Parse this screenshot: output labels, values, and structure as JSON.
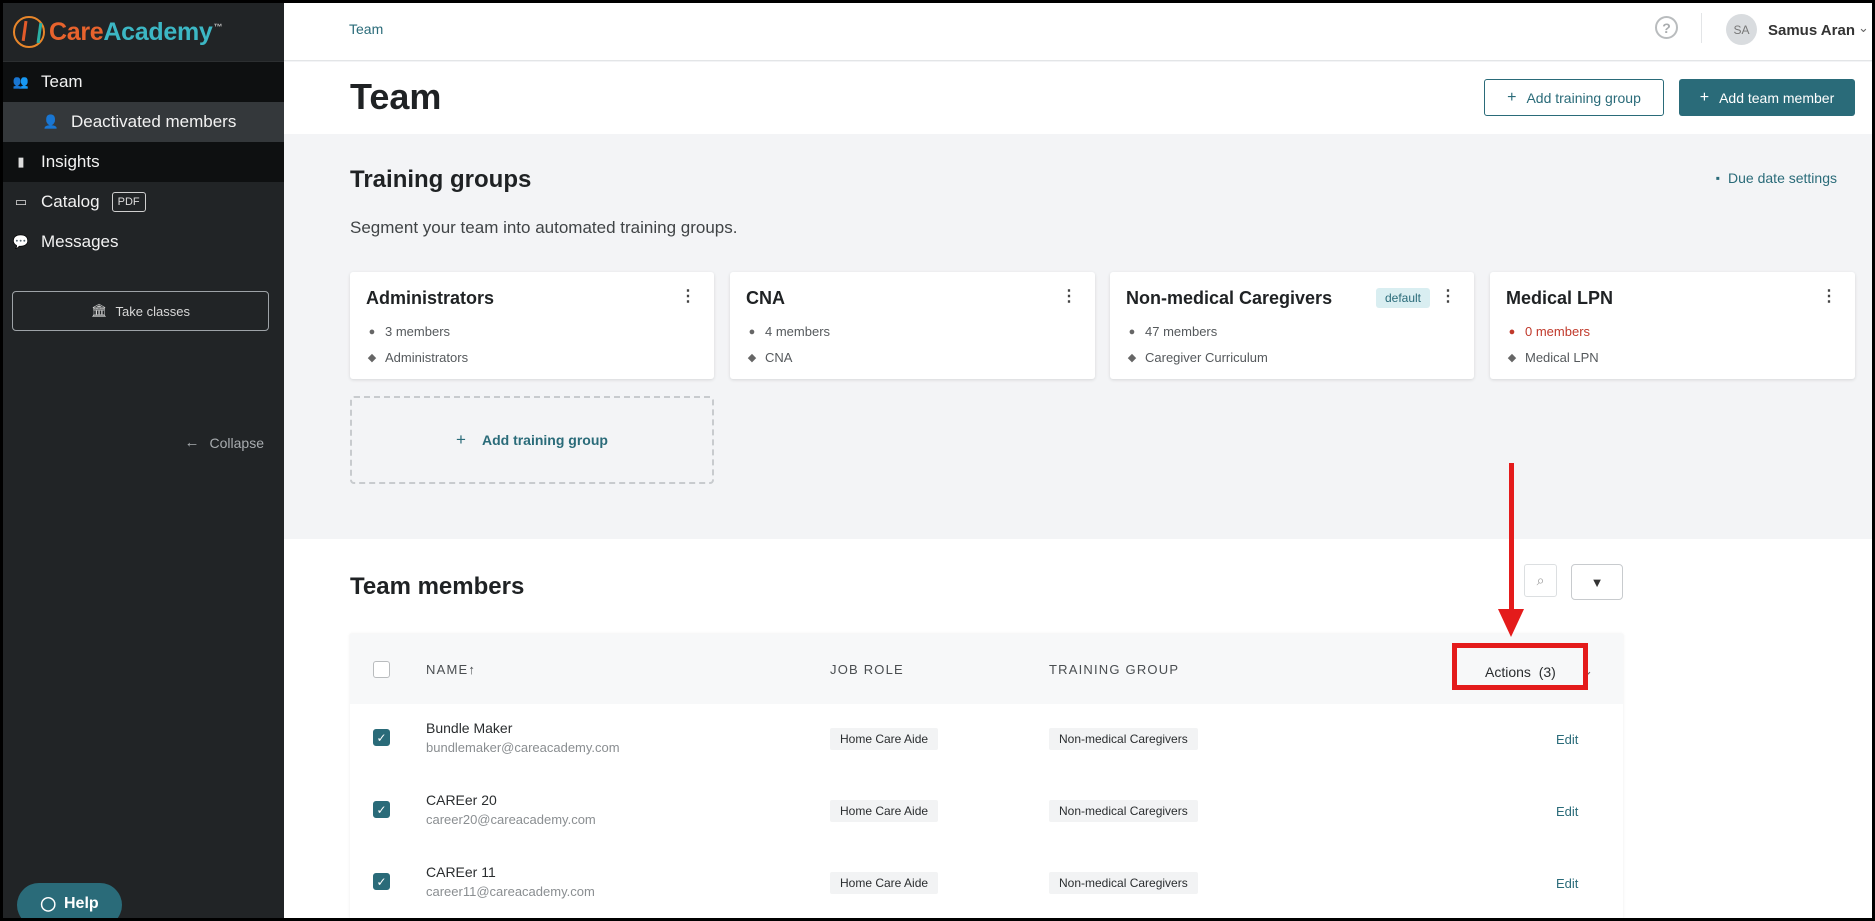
{
  "brand": {
    "care": "Care",
    "academy": "Academy",
    "tm": "™"
  },
  "sidebar": {
    "items": [
      {
        "label": "Team",
        "icon": "users-icon"
      },
      {
        "label": "Deactivated members",
        "icon": "user-icon"
      },
      {
        "label": "Insights",
        "icon": "bar-chart-icon"
      },
      {
        "label": "Catalog",
        "icon": "book-icon",
        "badge": "PDF"
      },
      {
        "label": "Messages",
        "icon": "chat-icon"
      }
    ],
    "take_classes": "Take classes",
    "collapse": "Collapse",
    "help": "Help"
  },
  "topbar": {
    "breadcrumb": "Team",
    "help_icon": "?",
    "avatar_initials": "SA",
    "user_name": "Samus Aran"
  },
  "header": {
    "title": "Team",
    "add_training_group": "Add training group",
    "add_team_member": "Add team member"
  },
  "training_groups": {
    "title": "Training groups",
    "subtitle": "Segment your team into automated training groups.",
    "due_date_settings": "Due date settings",
    "default_badge": "default",
    "add_card_label": "Add training group",
    "cards": [
      {
        "name": "Administrators",
        "members": "3 members",
        "curriculum": "Administrators"
      },
      {
        "name": "CNA",
        "members": "4 members",
        "curriculum": "CNA"
      },
      {
        "name": "Non-medical Caregivers",
        "members": "47 members",
        "curriculum": "Caregiver Curriculum"
      },
      {
        "name": "Medical LPN",
        "members": "0 members",
        "curriculum": "Medical LPN"
      }
    ]
  },
  "team_members": {
    "title": "Team members",
    "columns": {
      "name": "NAME↑",
      "job_role": "JOB ROLE",
      "training_group": "TRAINING GROUP"
    },
    "actions_label": "Actions",
    "actions_count": "(3)",
    "edit_label": "Edit",
    "rows": [
      {
        "name": "Bundle Maker",
        "email": "bundlemaker@careacademy.com",
        "job_role": "Home Care Aide",
        "training_group": "Non-medical Caregivers"
      },
      {
        "name": "CAREer 20",
        "email": "career20@careacademy.com",
        "job_role": "Home Care Aide",
        "training_group": "Non-medical Caregivers"
      },
      {
        "name": "CAREer 11",
        "email": "career11@careacademy.com",
        "job_role": "Home Care Aide",
        "training_group": "Non-medical Caregivers"
      }
    ]
  },
  "colors": {
    "primary": "#2a6b79",
    "sidebar": "#212426",
    "annotation": "#e41b1b",
    "warning": "#c0392b"
  }
}
